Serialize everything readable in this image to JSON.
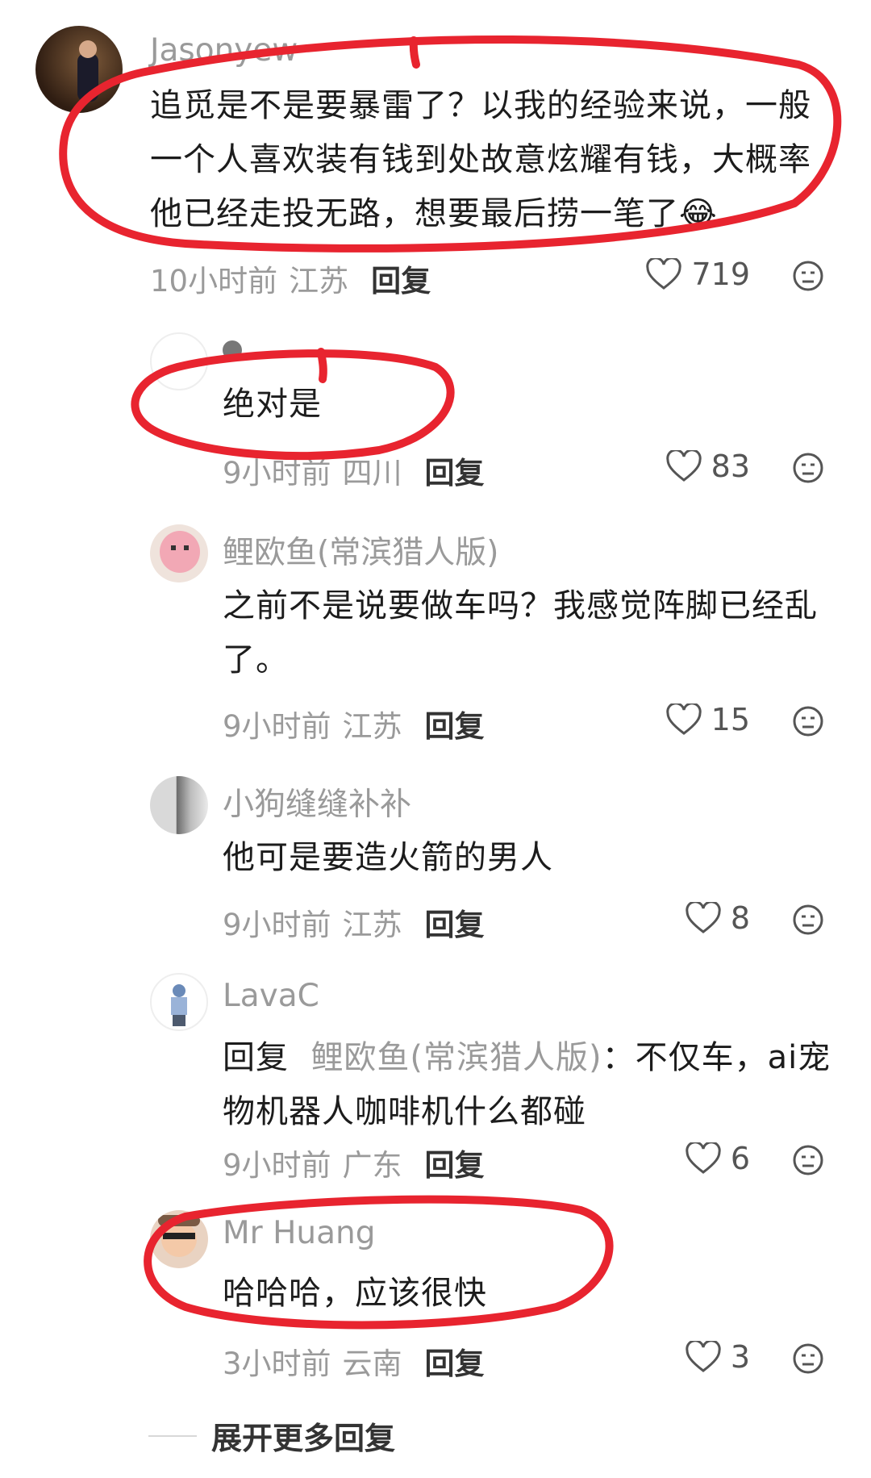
{
  "comments": [
    {
      "username": "Jasonyew",
      "text": "追觅是不是要暴雷了？以我的经验来说，一般一个人喜欢装有钱到处故意炫耀有钱，大概率他已经走投无路，想要最后捞一笔了😂",
      "time": "10小时前",
      "location": "江苏",
      "reply_label": "回复",
      "likes": "719"
    },
    {
      "username": "",
      "text": "绝对是",
      "time": "9小时前",
      "location": "四川",
      "reply_label": "回复",
      "likes": "83"
    },
    {
      "username": "鲤欧鱼(常滨猎人版)",
      "text": "之前不是说要做车吗？我感觉阵脚已经乱了。",
      "time": "9小时前",
      "location": "江苏",
      "reply_label": "回复",
      "likes": "15"
    },
    {
      "username": "小狗缝缝补补",
      "text": "他可是要造火箭的男人",
      "time": "9小时前",
      "location": "江苏",
      "reply_label": "回复",
      "likes": "8"
    },
    {
      "username": "LavaC",
      "reply_prefix": "回复",
      "reply_target": "鲤欧鱼(常滨猎人版)",
      "text": "：不仅车，ai宠物机器人咖啡机什么都碰",
      "time": "9小时前",
      "location": "广东",
      "reply_label": "回复",
      "likes": "6"
    },
    {
      "username": "Mr Huang",
      "text": "哈哈哈，应该很快",
      "time": "3小时前",
      "location": "云南",
      "reply_label": "回复",
      "likes": "3"
    }
  ],
  "expand_more": "展开更多回复",
  "colors": {
    "annotation": "#e8242f",
    "meta": "#9a9a9a",
    "text": "#1c1c1c"
  },
  "icons": [
    "heart-icon",
    "dislike-face-icon"
  ]
}
